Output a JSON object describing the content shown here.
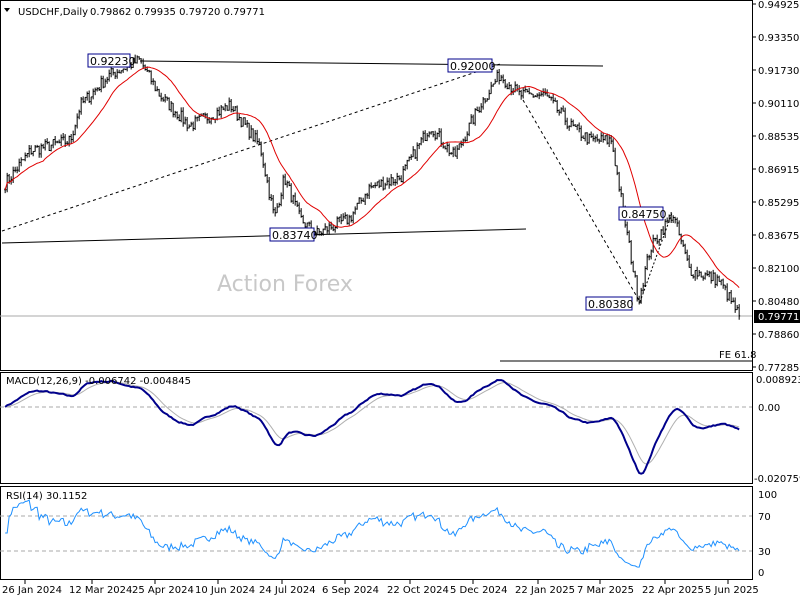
{
  "header": {
    "symbol": "USDCHF,Daily",
    "ohlc": "0.79862 0.79935 0.79720 0.79771"
  },
  "watermark": "Action Forex",
  "price_axis": [
    "0.94925",
    "0.93350",
    "0.91730",
    "0.90110",
    "0.88535",
    "0.86915",
    "0.85295",
    "0.83675",
    "0.82100",
    "0.80480",
    "0.78860",
    "0.77285"
  ],
  "current_price": "0.79771",
  "annotations": [
    "0.92230",
    "0.92000",
    "0.83740",
    "0.84750",
    "0.80380",
    "FE 61.8"
  ],
  "macd": {
    "label": "MACD(12,26,9) -0.006742 -0.004845",
    "axis": [
      "0.008923",
      "0.00",
      "-0.020759"
    ]
  },
  "rsi": {
    "label": "RSI(14) 30.1152",
    "axis": [
      "100",
      "70",
      "30",
      "0"
    ]
  },
  "x_axis": [
    "26 Jan 2024",
    "12 Mar 2024",
    "25 Apr 2024",
    "10 Jun 2024",
    "24 Jul 2024",
    "6 Sep 2024",
    "22 Oct 2024",
    "5 Dec 2024",
    "22 Jan 2025",
    "7 Mar 2025",
    "22 Apr 2025",
    "5 Jun 2025"
  ],
  "colors": {
    "bars": "#000000",
    "ma": "#e00000",
    "macd": "#00008b",
    "signal": "#b0b0b0",
    "rsi": "#1e90ff",
    "label_border": "#00008b"
  },
  "chart_data": {
    "type": "bar",
    "series_type": "ohlc",
    "price_path": [
      [
        "2024-01-12",
        0.862
      ],
      [
        "2024-01-30",
        0.878
      ],
      [
        "2024-02-27",
        0.883
      ],
      [
        "2024-03-05",
        0.9
      ],
      [
        "2024-03-26",
        0.915
      ],
      [
        "2024-04-16",
        0.922
      ],
      [
        "2024-04-30",
        0.905
      ],
      [
        "2024-05-21",
        0.89
      ],
      [
        "2024-06-19",
        0.9
      ],
      [
        "2024-07-10",
        0.88
      ],
      [
        "2024-07-20",
        0.845
      ],
      [
        "2024-07-27",
        0.865
      ],
      [
        "2024-08-07",
        0.845
      ],
      [
        "2024-08-18",
        0.8374
      ],
      [
        "2024-09-11",
        0.845
      ],
      [
        "2024-09-25",
        0.86
      ],
      [
        "2024-10-17",
        0.865
      ],
      [
        "2024-11-07",
        0.89
      ],
      [
        "2024-11-24",
        0.875
      ],
      [
        "2024-12-12",
        0.9
      ],
      [
        "2024-12-26",
        0.915
      ],
      [
        "2025-01-09",
        0.905
      ],
      [
        "2025-01-27",
        0.905
      ],
      [
        "2025-02-14",
        0.89
      ],
      [
        "2025-02-28",
        0.883
      ],
      [
        "2025-03-15",
        0.883
      ],
      [
        "2025-03-24",
        0.845
      ],
      [
        "2025-04-03",
        0.805
      ],
      [
        "2025-04-11",
        0.83
      ],
      [
        "2025-04-27",
        0.8475
      ],
      [
        "2025-05-09",
        0.82
      ],
      [
        "2025-05-30",
        0.815
      ],
      [
        "2025-06-13",
        0.7977
      ]
    ],
    "ylim": [
      0.77285,
      0.94925
    ]
  }
}
